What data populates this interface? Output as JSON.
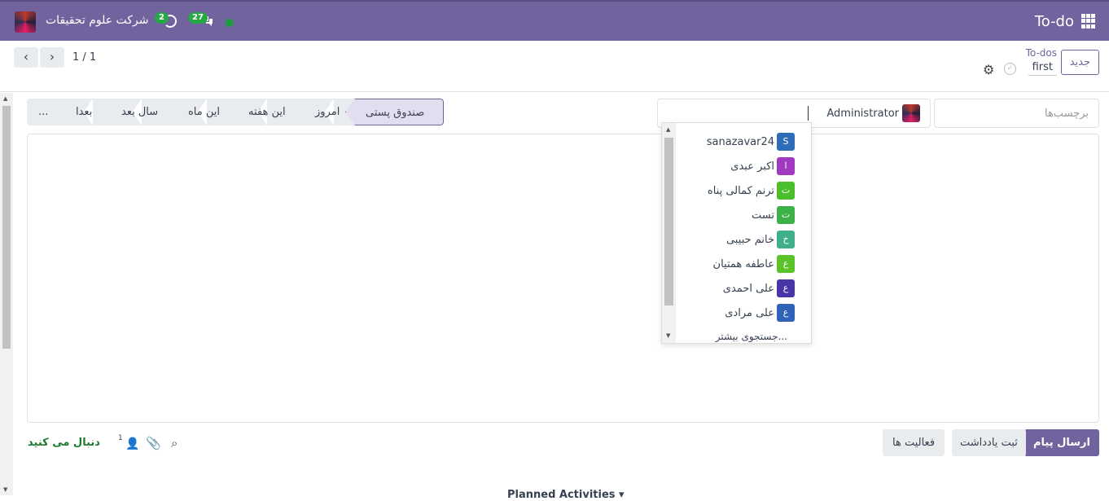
{
  "navbar": {
    "app_name": "To-do",
    "company": "شرکت علوم تحقیقات",
    "activity_count": "2",
    "message_count": "27",
    "colors": {
      "bar": "#71639e",
      "status": "#1e9b3b"
    }
  },
  "control_panel": {
    "new_button": "جدید",
    "breadcrumb_parent": "To-dos",
    "breadcrumb_current": "first",
    "pager_value": "1 / 1"
  },
  "fields": {
    "tags_placeholder": "برچسب‌ها",
    "assignee": "Administrator"
  },
  "date_tabs": [
    "صندوق پستی",
    "امروز",
    "این هفته",
    "این ماه",
    "سال بعد",
    "بعدا",
    "..."
  ],
  "user_dropdown": {
    "items": [
      {
        "initial": "S",
        "name": "sanazavar24",
        "color": "#2e6bb8"
      },
      {
        "initial": "ا",
        "name": "اکبر عبدی",
        "color": "#a23ac0"
      },
      {
        "initial": "ت",
        "name": "ترنم کمالی پناه",
        "color": "#4bbf2b"
      },
      {
        "initial": "ت",
        "name": "تست",
        "color": "#3db04a"
      },
      {
        "initial": "خ",
        "name": "خانم حبیبی",
        "color": "#3fae8a"
      },
      {
        "initial": "ع",
        "name": "عاطفه همتیان",
        "color": "#5cc22a"
      },
      {
        "initial": "ع",
        "name": "علی احمدی",
        "color": "#4a35a8"
      },
      {
        "initial": "ع",
        "name": "علی مرادی",
        "color": "#2f62b8"
      }
    ],
    "search_more": "جستجوی بیشتر..."
  },
  "chatter": {
    "send_message": "ارسال پیام",
    "log_note": "ثبت یادداشت",
    "activities": "فعالیت ها",
    "follow": "دنبال می کنید",
    "follower_count": "1",
    "planned_activities": "Planned Activities ▾"
  }
}
